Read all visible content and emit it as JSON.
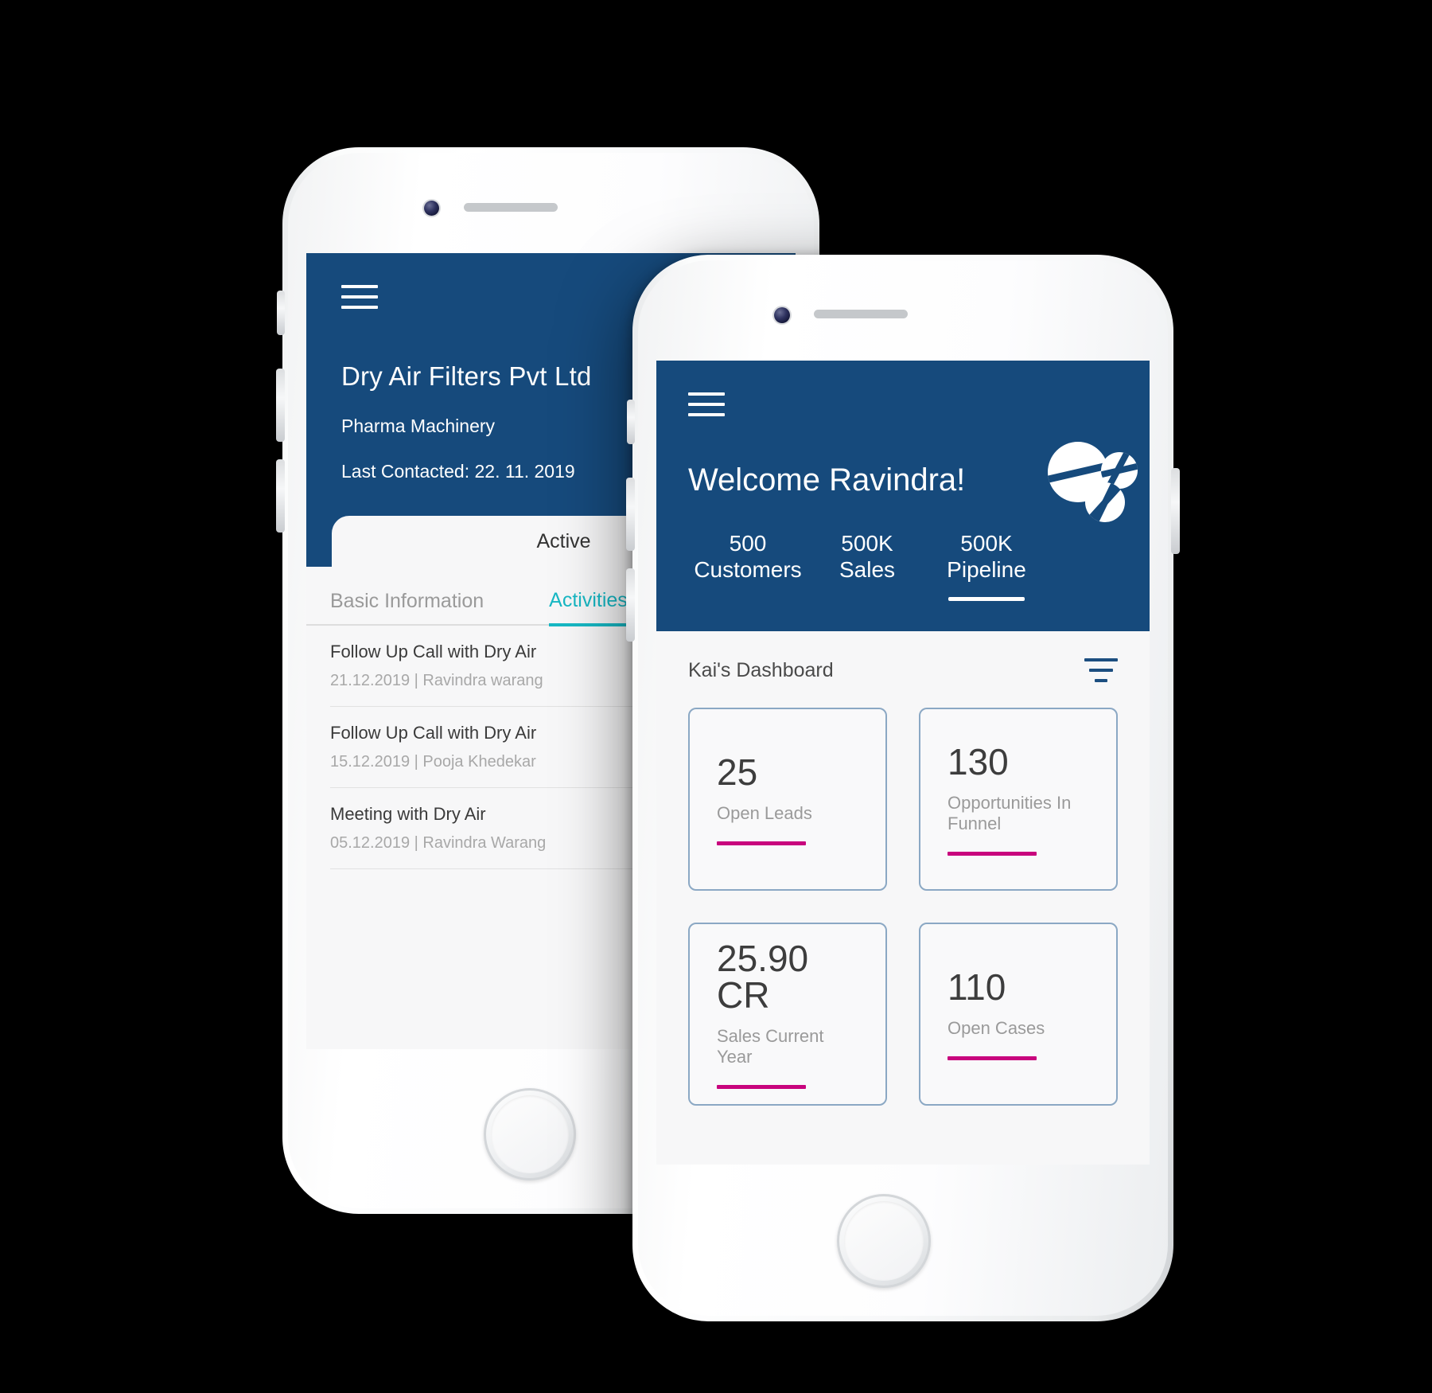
{
  "theme": {
    "brand_blue": "#164a7c",
    "accent_teal": "#17b8c4",
    "accent_magenta": "#c8047d",
    "screen_bg": "#f7f7f8",
    "page_bg": "#000000"
  },
  "detail_phone": {
    "menu_icon": "hamburger-menu-icon",
    "account_name": "Dry Air Filters Pvt Ltd",
    "industry": "Pharma Machinery",
    "last_contacted": "Last Contacted: 22. 11. 2019",
    "status_tab": "Active",
    "sub_tabs": [
      {
        "label": "Basic Information",
        "active": false
      },
      {
        "label": "Activities",
        "active": true
      }
    ],
    "activities": [
      {
        "title": "Follow Up Call with Dry Air",
        "meta": "21.12.2019 | Ravindra warang"
      },
      {
        "title": "Follow Up Call with Dry Air",
        "meta": "15.12.2019 | Pooja Khedekar"
      },
      {
        "title": "Meeting with Dry Air",
        "meta": "05.12.2019 | Ravindra Warang"
      }
    ]
  },
  "dashboard_phone": {
    "menu_icon": "hamburger-menu-icon",
    "logo_icon": "brand-logo-icon",
    "welcome": "Welcome Ravindra!",
    "stats": [
      {
        "value": "500",
        "label": "Customers",
        "active": false
      },
      {
        "value": "500K",
        "label": "Sales",
        "active": false
      },
      {
        "value": "500K",
        "label": "Pipeline",
        "active": true
      }
    ],
    "dashboard_title": "Kai's Dashboard",
    "filter_icon": "filter-icon",
    "kpis": [
      {
        "value": "25",
        "label": "Open Leads"
      },
      {
        "value": "130",
        "label": "Opportunities In Funnel"
      },
      {
        "value": "25.90 CR",
        "label": "Sales Current Year"
      },
      {
        "value": "110",
        "label": "Open Cases"
      }
    ]
  }
}
